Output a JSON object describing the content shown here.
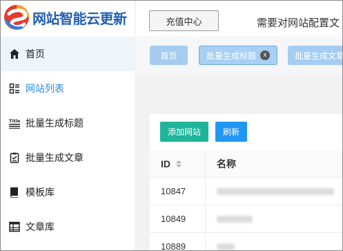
{
  "sidebar": {
    "logo_text": "网站智能云更新",
    "items": [
      {
        "label": "首页",
        "icon": "home-icon"
      },
      {
        "label": "网站列表",
        "icon": "list-icon"
      },
      {
        "label": "批量生成标题",
        "icon": "title-icon"
      },
      {
        "label": "批量生成文章",
        "icon": "document-icon"
      },
      {
        "label": "模板库",
        "icon": "book-icon"
      },
      {
        "label": "文章库",
        "icon": "table-icon"
      }
    ]
  },
  "header": {
    "recharge_label": "充值中心",
    "notice_text": "需要对网站配置文"
  },
  "tabs": [
    {
      "label": "首页"
    },
    {
      "label": "批量生成标题",
      "close": "x"
    },
    {
      "label": "批量生成文章"
    }
  ],
  "toolbar": {
    "add_label": "添加网站",
    "refresh_label": "刷新"
  },
  "table": {
    "headers": {
      "id": "ID",
      "name": "名称"
    },
    "rows": [
      {
        "id": "10847"
      },
      {
        "id": "10849"
      },
      {
        "id": "10889"
      }
    ]
  },
  "colors": {
    "brand_blue": "#1f5fb0",
    "active_nav": "#2a8ce8",
    "tab_bg": "#a5cdf3",
    "add_button": "#1fb59b",
    "refresh_button": "#2196f3"
  }
}
